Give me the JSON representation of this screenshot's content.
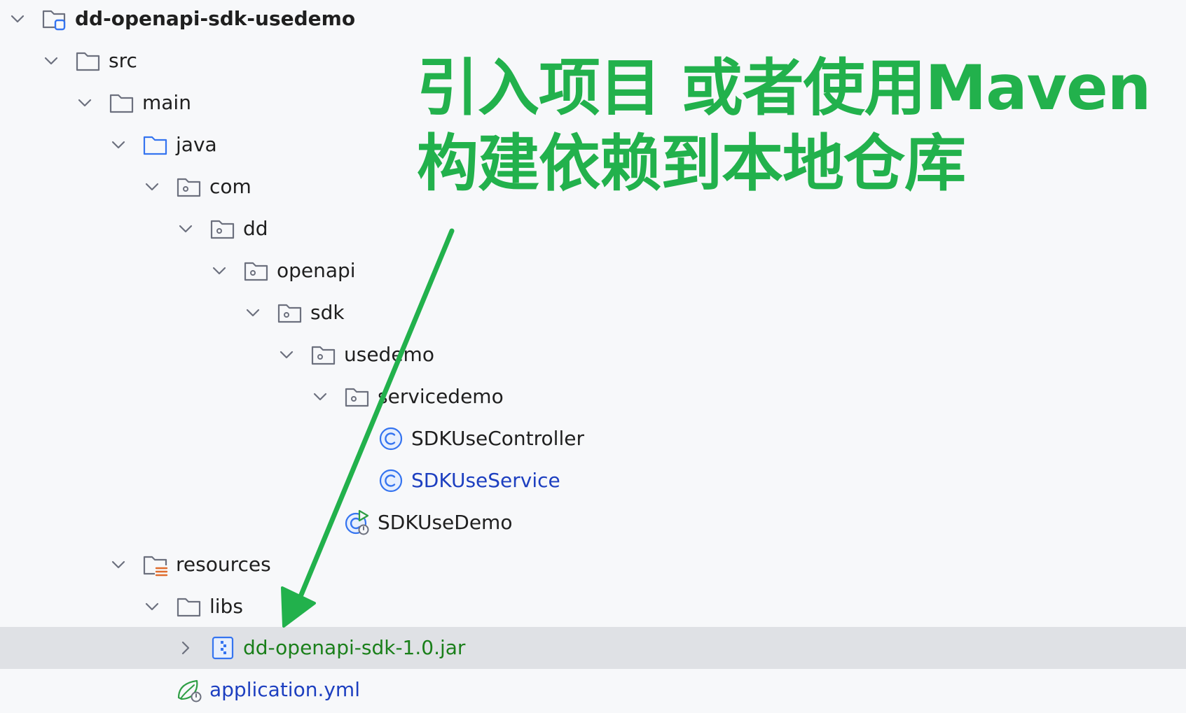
{
  "tree": {
    "rows": [
      {
        "label": "dd-openapi-sdk-usedemo",
        "icon": "module-folder-icon"
      },
      {
        "label": "src",
        "icon": "folder-icon"
      },
      {
        "label": "main",
        "icon": "folder-icon"
      },
      {
        "label": "java",
        "icon": "source-folder-icon"
      },
      {
        "label": "com",
        "icon": "package-icon"
      },
      {
        "label": "dd",
        "icon": "package-icon"
      },
      {
        "label": "openapi",
        "icon": "package-icon"
      },
      {
        "label": "sdk",
        "icon": "package-icon"
      },
      {
        "label": "usedemo",
        "icon": "package-icon"
      },
      {
        "label": "servicedemo",
        "icon": "package-icon"
      },
      {
        "label": "SDKUseController",
        "icon": "java-class-icon"
      },
      {
        "label": "SDKUseService",
        "icon": "java-class-icon"
      },
      {
        "label": "SDKUseDemo",
        "icon": "spring-boot-class-icon"
      },
      {
        "label": "resources",
        "icon": "resources-folder-icon"
      },
      {
        "label": "libs",
        "icon": "folder-icon"
      },
      {
        "label": "dd-openapi-sdk-1.0.jar",
        "icon": "jar-archive-icon"
      },
      {
        "label": "application.yml",
        "icon": "spring-config-icon"
      }
    ]
  },
  "annotation": {
    "line1": "引入项目 或者使用Maven",
    "line2": "构建依赖到本地仓库",
    "color": "#22b14c"
  },
  "colors": {
    "background": "#f7f8fa",
    "selected_row": "#dfe1e5",
    "class_blue": "#1d3fc0",
    "jar_green": "#1a7f1a",
    "icon_blue": "#3574f0",
    "arrow_green": "#22b14c"
  }
}
